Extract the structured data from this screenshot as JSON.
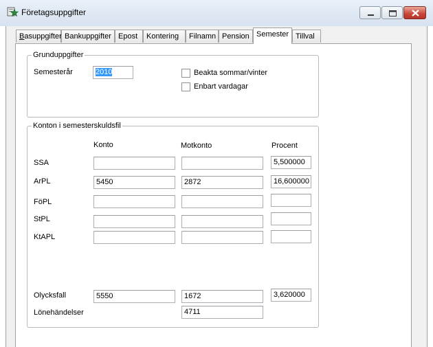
{
  "window": {
    "title": "Företagsuppgifter"
  },
  "tabs": [
    {
      "label": "Basuppgifter"
    },
    {
      "label": "Bankuppgifter"
    },
    {
      "label": "Epost"
    },
    {
      "label": "Kontering"
    },
    {
      "label": "Filnamn"
    },
    {
      "label": "Pension"
    },
    {
      "label": "Semester"
    },
    {
      "label": "Tillval"
    }
  ],
  "active_tab": "Semester",
  "grund": {
    "title": "Grunduppgifter",
    "year_label": "Semesterår",
    "year_value": "2010",
    "check_summer": "Beakta sommar/vinter",
    "check_weekdays": "Enbart vardagar"
  },
  "konton": {
    "title": "Konton i semesterskuldsfil",
    "col_konto": "Konto",
    "col_motkonto": "Motkonto",
    "col_procent": "Procent",
    "rows": [
      {
        "label": "SSA",
        "konto": "",
        "motkonto": "",
        "procent": "5,500000"
      },
      {
        "label": "ArPL",
        "konto": "5450",
        "motkonto": "2872",
        "procent": "16,600000"
      },
      {
        "label": "FöPL",
        "konto": "",
        "motkonto": "",
        "procent": ""
      },
      {
        "label": "StPL",
        "konto": "",
        "motkonto": "",
        "procent": ""
      },
      {
        "label": "KtAPL",
        "konto": "",
        "motkonto": "",
        "procent": ""
      }
    ],
    "olycksfall": {
      "label": "Olycksfall",
      "konto": "5550",
      "motkonto": "1672",
      "procent": "3,620000"
    },
    "lonehandelser": {
      "label": "Lönehändelser",
      "motkonto": "4711"
    }
  }
}
